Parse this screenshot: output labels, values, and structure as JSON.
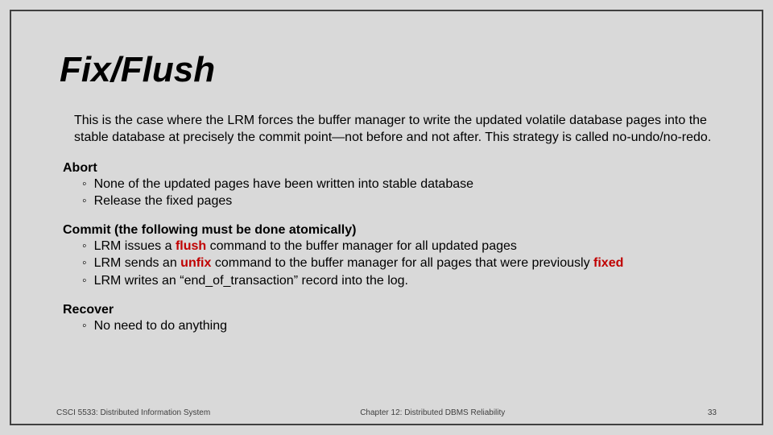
{
  "title": "Fix/Flush",
  "intro": "This is the case where the LRM forces the buffer manager to write the updated volatile database pages into the stable database at precisely the commit point—not before and not after. This strategy is called no-undo/no-redo.",
  "sections": {
    "abort": {
      "heading": "Abort",
      "items": [
        "None of the updated pages have been written into stable database",
        "Release the fixed pages"
      ]
    },
    "commit": {
      "heading": "Commit (the following must be done atomically)",
      "line1_pre": "LRM issues a ",
      "line1_kw": "flush",
      "line1_post": " command to the buffer manager for all updated pages",
      "line2_pre": "LRM sends an ",
      "line2_kw": "unfix",
      "line2_mid": " command to the buffer manager for all pages that were previously ",
      "line2_kw2": "fixed",
      "line3": "LRM writes an “end_of_transaction” record into the log."
    },
    "recover": {
      "heading": "Recover",
      "items": [
        "No need to do anything"
      ]
    }
  },
  "footer": {
    "left": "CSCI 5533: Distributed Information System",
    "mid": "Chapter 12: Distributed DBMS Reliability",
    "right": "33"
  }
}
